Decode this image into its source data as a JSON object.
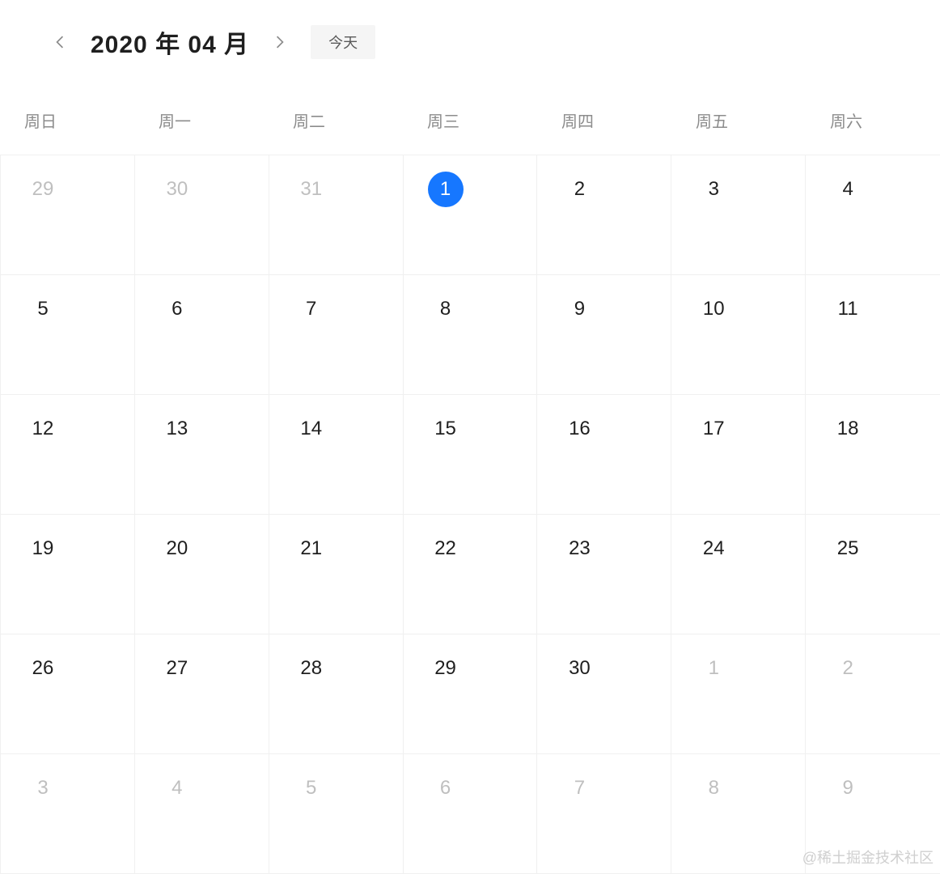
{
  "header": {
    "title": "2020 年 04 月",
    "today_label": "今天"
  },
  "weekdays": [
    "周日",
    "周一",
    "周二",
    "周三",
    "周四",
    "周五",
    "周六"
  ],
  "cells": [
    {
      "n": "29",
      "outside": true,
      "today": false
    },
    {
      "n": "30",
      "outside": true,
      "today": false
    },
    {
      "n": "31",
      "outside": true,
      "today": false
    },
    {
      "n": "1",
      "outside": false,
      "today": true
    },
    {
      "n": "2",
      "outside": false,
      "today": false
    },
    {
      "n": "3",
      "outside": false,
      "today": false
    },
    {
      "n": "4",
      "outside": false,
      "today": false
    },
    {
      "n": "5",
      "outside": false,
      "today": false
    },
    {
      "n": "6",
      "outside": false,
      "today": false
    },
    {
      "n": "7",
      "outside": false,
      "today": false
    },
    {
      "n": "8",
      "outside": false,
      "today": false
    },
    {
      "n": "9",
      "outside": false,
      "today": false
    },
    {
      "n": "10",
      "outside": false,
      "today": false
    },
    {
      "n": "11",
      "outside": false,
      "today": false
    },
    {
      "n": "12",
      "outside": false,
      "today": false
    },
    {
      "n": "13",
      "outside": false,
      "today": false
    },
    {
      "n": "14",
      "outside": false,
      "today": false
    },
    {
      "n": "15",
      "outside": false,
      "today": false
    },
    {
      "n": "16",
      "outside": false,
      "today": false
    },
    {
      "n": "17",
      "outside": false,
      "today": false
    },
    {
      "n": "18",
      "outside": false,
      "today": false
    },
    {
      "n": "19",
      "outside": false,
      "today": false
    },
    {
      "n": "20",
      "outside": false,
      "today": false
    },
    {
      "n": "21",
      "outside": false,
      "today": false
    },
    {
      "n": "22",
      "outside": false,
      "today": false
    },
    {
      "n": "23",
      "outside": false,
      "today": false
    },
    {
      "n": "24",
      "outside": false,
      "today": false
    },
    {
      "n": "25",
      "outside": false,
      "today": false
    },
    {
      "n": "26",
      "outside": false,
      "today": false
    },
    {
      "n": "27",
      "outside": false,
      "today": false
    },
    {
      "n": "28",
      "outside": false,
      "today": false
    },
    {
      "n": "29",
      "outside": false,
      "today": false
    },
    {
      "n": "30",
      "outside": false,
      "today": false
    },
    {
      "n": "1",
      "outside": true,
      "today": false
    },
    {
      "n": "2",
      "outside": true,
      "today": false
    },
    {
      "n": "3",
      "outside": true,
      "today": false
    },
    {
      "n": "4",
      "outside": true,
      "today": false
    },
    {
      "n": "5",
      "outside": true,
      "today": false
    },
    {
      "n": "6",
      "outside": true,
      "today": false
    },
    {
      "n": "7",
      "outside": true,
      "today": false
    },
    {
      "n": "8",
      "outside": true,
      "today": false
    },
    {
      "n": "9",
      "outside": true,
      "today": false
    }
  ],
  "watermark": "@稀土掘金技术社区"
}
